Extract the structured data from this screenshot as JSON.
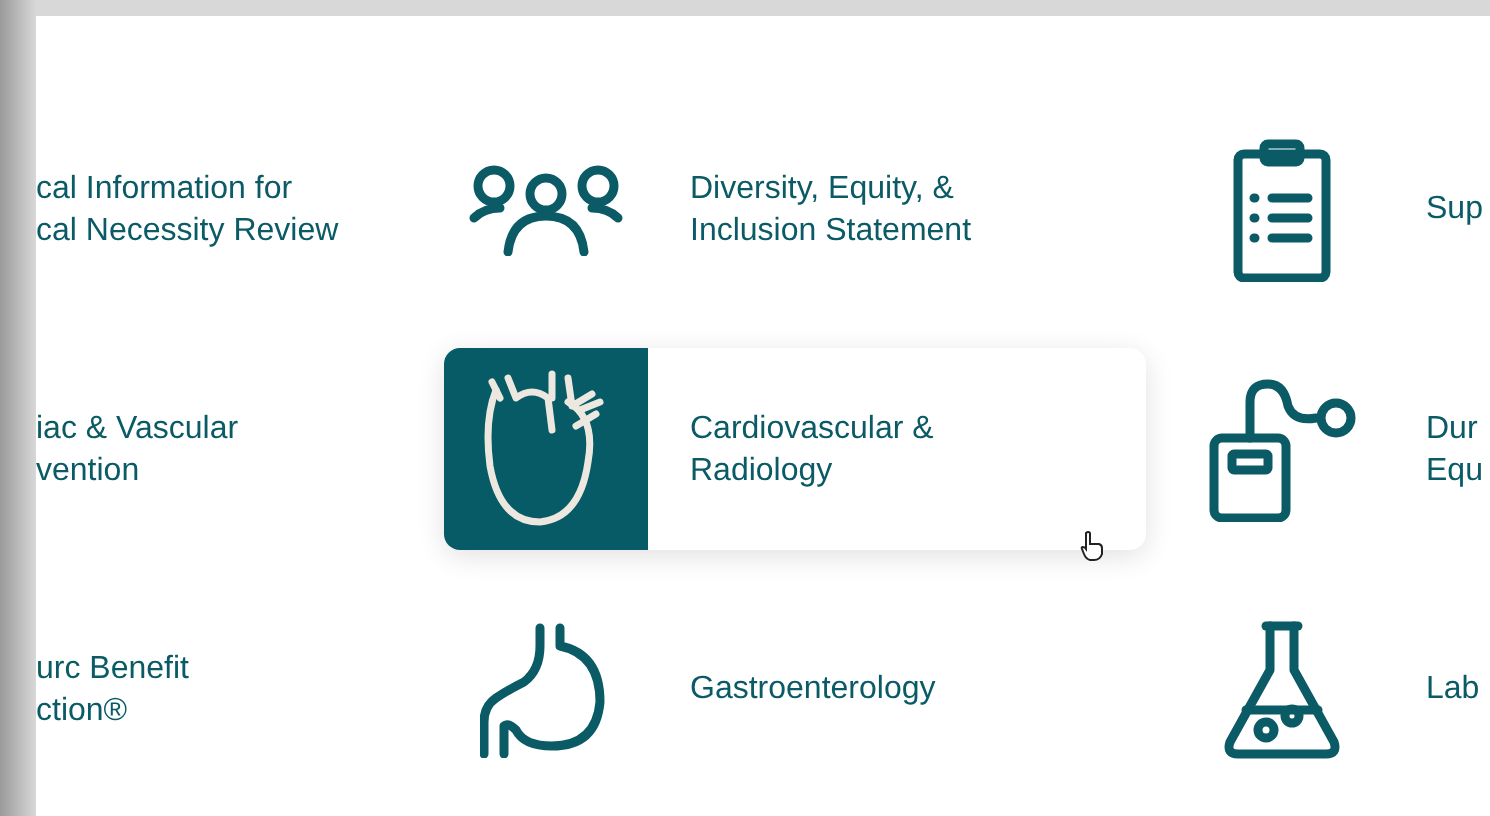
{
  "tiles": [
    {
      "lines": [
        "cal Information for",
        "cal Necessity Review"
      ],
      "highlighted": false
    },
    {
      "kind": "people",
      "lines": [
        "Diversity, Equity, &",
        "Inclusion Statement"
      ],
      "highlighted": false
    },
    {
      "kind": "clipboard",
      "lines": [
        "Sup"
      ],
      "highlighted": false
    },
    {
      "lines": [
        "iac & Vascular",
        "vention"
      ],
      "highlighted": false
    },
    {
      "kind": "heart",
      "lines": [
        "Cardiovascular &",
        "Radiology"
      ],
      "highlighted": true
    },
    {
      "kind": "device",
      "lines": [
        "Dur",
        "Equ"
      ],
      "highlighted": false
    },
    {
      "lines": [
        "urc Benefit",
        "ction®"
      ],
      "highlighted": false
    },
    {
      "kind": "stomach",
      "lines": [
        "Gastroenterology"
      ],
      "highlighted": false
    },
    {
      "kind": "flask",
      "lines": [
        "Lab"
      ],
      "highlighted": false
    }
  ]
}
